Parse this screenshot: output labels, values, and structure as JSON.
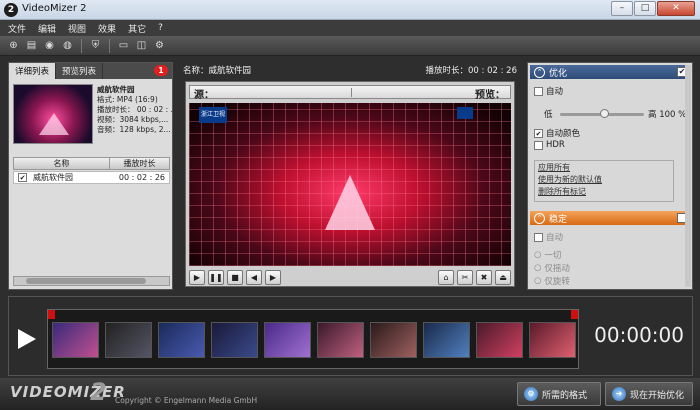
{
  "window": {
    "title": "VideoMizer 2",
    "app_icon": "2"
  },
  "menu": [
    "文件",
    "编辑",
    "视图",
    "效果",
    "其它",
    "?"
  ],
  "left": {
    "tabs": [
      "详细列表",
      "预览列表"
    ],
    "badge": "1",
    "video": {
      "name": "威航软件园",
      "format": "格式: MP4 (16:9)",
      "duration": "播放时长： 00 : 02 : ...",
      "video": "视频：3084 kbps,...",
      "audio": "音频：128 kbps, 2..."
    },
    "columns": [
      "名称",
      "播放时长"
    ],
    "rows": [
      {
        "name": "威航软件园",
        "duration": "00 : 02 : 26",
        "checked": "✔"
      }
    ]
  },
  "center": {
    "name_label": "名称：威航软件园",
    "duration_label": "播放时长：00 : 02 : 26",
    "source": "源：",
    "preview": "预览：",
    "logo": "浙江卫视"
  },
  "right": {
    "section1": {
      "title": "优化",
      "checked": "✔"
    },
    "auto": "自动",
    "low": "低",
    "high": "高",
    "percent": "100 %",
    "auto_color": "自动颜色",
    "auto_color_checked": "✔",
    "hdr": "HDR",
    "links": [
      "应用所有",
      "使用为新的默认值",
      "删除所有标记"
    ],
    "section2": {
      "title": "稳定"
    },
    "auto2": "自动",
    "opt1": "一切",
    "opt2": "仅摇动",
    "opt3": "仅旋转"
  },
  "timeline": {
    "timecode": "00:00:00"
  },
  "bottom": {
    "brand": "VIDEOMIZER",
    "brand_num": "2",
    "copyright": "Copyright © Engelmann Media GmbH",
    "btn_format": "所需的格式",
    "btn_start": "现在开始优化"
  },
  "colors": {
    "accent_blue": "#2c4b78",
    "accent_orange": "#d86a14",
    "badge_red": "#e02020"
  }
}
